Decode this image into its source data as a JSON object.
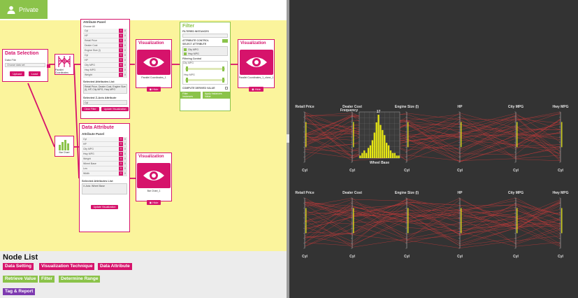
{
  "topbar": {
    "private_label": "Private"
  },
  "nodes": {
    "data_selection": {
      "title": "Data Selection",
      "file_label": "Data File",
      "file_value": "Choose data set",
      "upload_label": "Upload",
      "load_label": "Load"
    },
    "pcp_node": {
      "caption": "Parallel Coordinates"
    },
    "attr_panel_top": {
      "title": "Attribute Panel",
      "subtitle": "Choose All",
      "rows": [
        "Cyl",
        "HP",
        "Retail Price",
        "Dealer Cost",
        "Engine Size (l)",
        "Cyl",
        "HP",
        "City MPG",
        "Hwy MPG",
        "Weight"
      ],
      "selected_list_label": "Selected Attributes List",
      "selected_list_items": "Retail Price, Dealer Cost, Engine Size (l), HP, City MPG, Hwy MPG",
      "z_axis_label": "Selected Z-Axis Attribute",
      "z_axis_value": "Cyl",
      "btn_clear": "Clear Filter",
      "btn_update": "Update Visualization"
    },
    "vis_top": {
      "title": "Visualization",
      "caption": "Parallel Coordinates_1",
      "hide_label": "Hide"
    },
    "filter": {
      "title": "Filter",
      "filtered_label": "FILTERED INSTANCES",
      "attr_control_label": "ATTRIBUTE CONTROL",
      "select_attr_label": "SELECT ATTRIBUTE",
      "checks": [
        "City MPG",
        "Hwy MPG"
      ],
      "filtering_control_label": "Filtering Control",
      "slider_a": "City MPG",
      "slider_b": "Hwy MPG",
      "compute_label": "COMPUTE DERIVED VALUE",
      "btn_a": "Filter Instances",
      "btn_b": "Apply Instances Value"
    },
    "vis_top_right": {
      "title": "Visualization",
      "caption": "Parallel Coordinates_1_clone_1",
      "hide_label": "Hide"
    },
    "bar_node": {
      "caption": "Bar Chart"
    },
    "data_attribute": {
      "title": "Data Attribute",
      "panel_label": "Attribute Panel",
      "rows": [
        "Cyl",
        "HP",
        "City MPG",
        "Hwy MPG",
        "Weight",
        "Wheel Base",
        "Len",
        "Width"
      ],
      "selected_list_label": "Selected Attributes List",
      "selected_list_items": "X-Axis: Wheel Base",
      "btn_update": "Update Visualization"
    },
    "vis_bottom": {
      "title": "Visualization",
      "caption": "Bar Chart_1",
      "hide_label": "Hide"
    }
  },
  "node_list": {
    "title": "Node List",
    "row1": [
      "Data Setting",
      "Visualization Technique",
      "Data Attribute"
    ],
    "row2": [
      "Retrieve Value",
      "Filter",
      "Determine Range"
    ],
    "row3": [
      "Tag & Report"
    ]
  },
  "vis_panel": {
    "top_axes": [
      "Retail Price",
      "Dealer Cost",
      "Engine Size (l)",
      "HP",
      "City MPG",
      "Hwy MPG"
    ],
    "bottom_axes": [
      "Retail Price",
      "Dealer Cost",
      "Engine Size (l)",
      "HP",
      "City MPG",
      "Hwy MPG"
    ],
    "z_labels": [
      "Cyl",
      "Cyl",
      "Cyl",
      "Cyl",
      "Cyl",
      "Cyl"
    ],
    "histogram_xlabel": "Wheel Base",
    "histogram_ylabel": "Frequency",
    "histogram_peak_label": "17",
    "histogram_values": [
      1,
      2,
      3,
      2,
      4,
      5,
      7,
      10,
      14,
      17,
      13,
      11,
      9,
      6,
      5,
      3,
      2,
      2,
      1,
      1
    ]
  },
  "colors": {
    "pink": "#d6136b",
    "green": "#8bc34a",
    "purple": "#7e3ab0",
    "canvas_yellow": "#fbf49c",
    "vis_bg": "#333333",
    "line_red": "#c73a3a",
    "highlight_yellow": "#e6e614"
  }
}
